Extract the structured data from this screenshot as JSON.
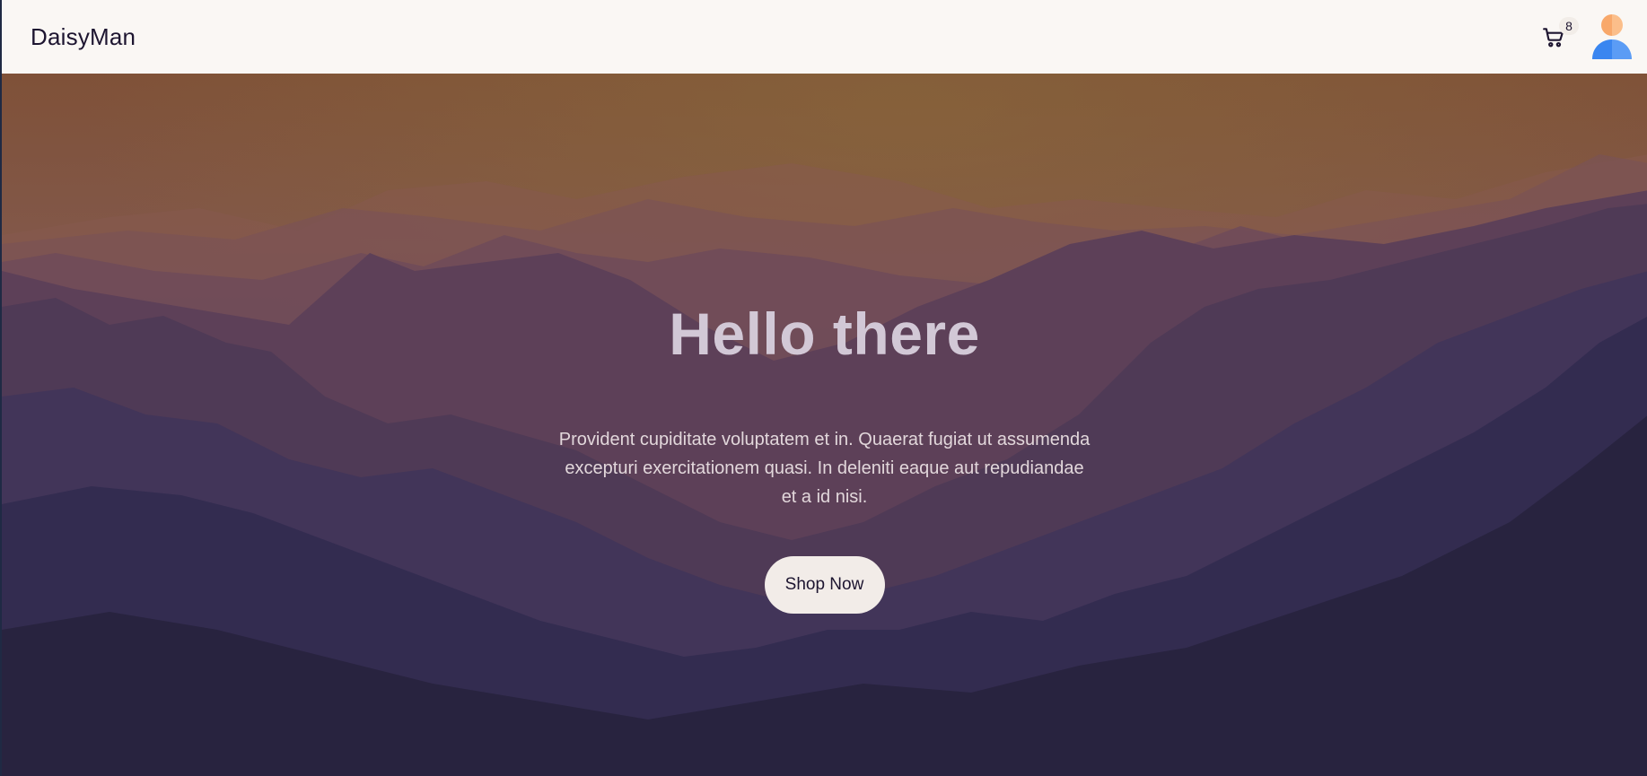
{
  "navbar": {
    "brand": "DaisyMan",
    "cart_count": "8",
    "cart_icon": "shopping-cart-icon",
    "avatar_icon": "user-avatar-icon"
  },
  "hero": {
    "title": "Hello there",
    "text": "Provident cupiditate voluptatem et in. Quaerat fugiat ut assumenda excepturi exercitationem quasi. In deleniti eaque aut repudiandae et a id nisi.",
    "button_label": "Shop Now"
  },
  "colors": {
    "navbar_bg": "#faf7f4",
    "sky_top": "#7f5138",
    "mountains_far": "#6a4a5a",
    "mountains_near": "#262244",
    "button_bg": "#f2ece8"
  }
}
